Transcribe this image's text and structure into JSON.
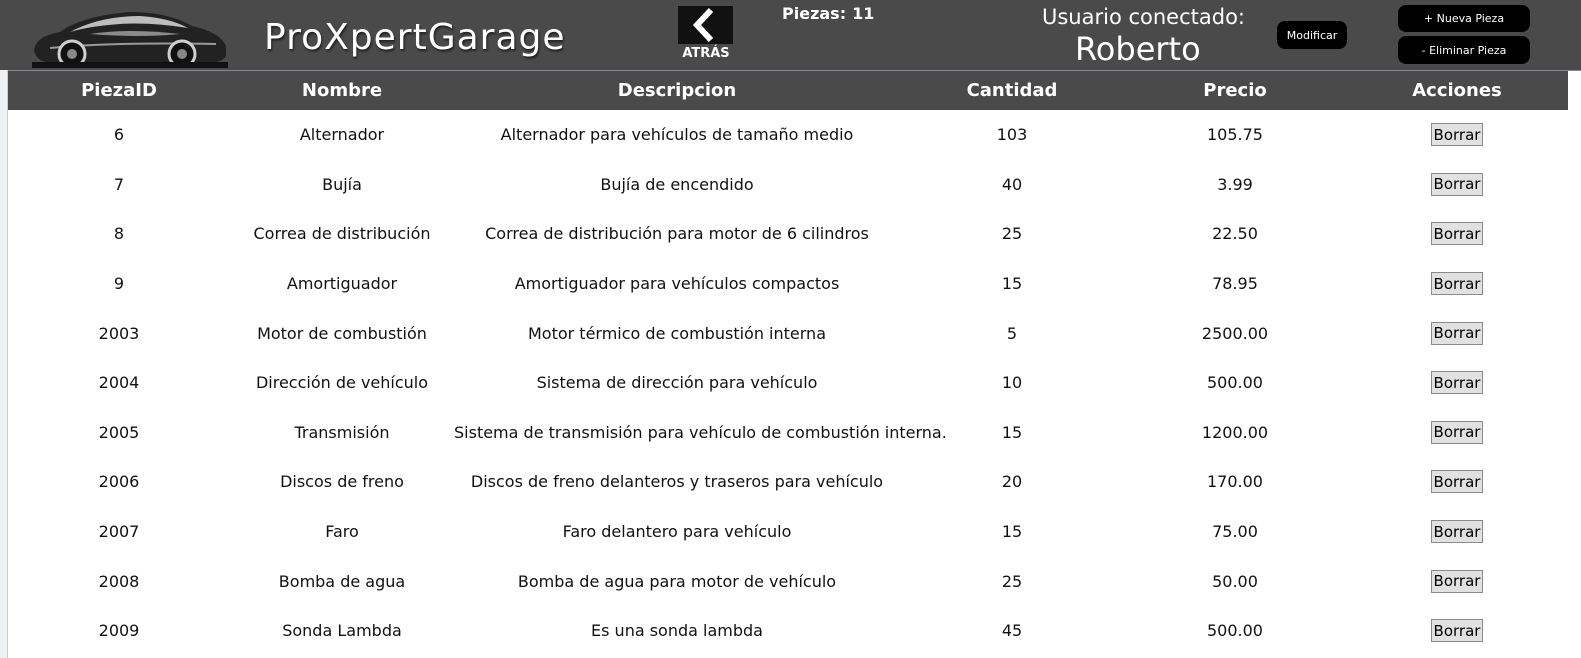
{
  "header": {
    "app_title": "ProXpertGarage",
    "back_label": "ATRÁS",
    "pieces_label": "Piezas:",
    "pieces_count": "11",
    "user_label": "Usuario conectado:",
    "user_name": "Roberto",
    "modify_label": "Modificar",
    "new_piece_label": "+ Nueva Pieza",
    "delete_piece_label": "- Eliminar Pieza",
    "logo_icon": "car-logo-icon",
    "back_icon": "chevron-left-icon"
  },
  "colors": {
    "header_bg": "#4a4a4a",
    "button_bg": "#000000",
    "row_button_bg": "#e1e1e1"
  },
  "table": {
    "columns": [
      "PiezaID",
      "Nombre",
      "Descripcion",
      "Cantidad",
      "Precio",
      "Acciones"
    ],
    "action_label": "Borrar",
    "rows": [
      {
        "id": "6",
        "nombre": "Alternador",
        "descripcion": "Alternador para vehículos de tamaño medio",
        "cantidad": "103",
        "precio": "105.75"
      },
      {
        "id": "7",
        "nombre": "Bujía",
        "descripcion": "Bujía de encendido",
        "cantidad": "40",
        "precio": "3.99"
      },
      {
        "id": "8",
        "nombre": "Correa de distribución",
        "descripcion": "Correa de distribución para motor de 6 cilindros",
        "cantidad": "25",
        "precio": "22.50"
      },
      {
        "id": "9",
        "nombre": "Amortiguador",
        "descripcion": "Amortiguador para vehículos compactos",
        "cantidad": "15",
        "precio": "78.95"
      },
      {
        "id": "2003",
        "nombre": "Motor de combustión",
        "descripcion": "Motor térmico de combustión interna",
        "cantidad": "5",
        "precio": "2500.00"
      },
      {
        "id": "2004",
        "nombre": "Dirección de vehículo",
        "descripcion": "Sistema de dirección para vehículo",
        "cantidad": "10",
        "precio": "500.00"
      },
      {
        "id": "2005",
        "nombre": "Transmisión",
        "descripcion": "Sistema de transmisión para vehículo de combustión interna.",
        "cantidad": "15",
        "precio": "1200.00"
      },
      {
        "id": "2006",
        "nombre": "Discos de freno",
        "descripcion": "Discos de freno delanteros y traseros para vehículo",
        "cantidad": "20",
        "precio": "170.00"
      },
      {
        "id": "2007",
        "nombre": "Faro",
        "descripcion": "Faro delantero para vehículo",
        "cantidad": "15",
        "precio": "75.00"
      },
      {
        "id": "2008",
        "nombre": "Bomba de agua",
        "descripcion": "Bomba de agua para motor de vehículo",
        "cantidad": "25",
        "precio": "50.00"
      },
      {
        "id": "2009",
        "nombre": "Sonda Lambda",
        "descripcion": "Es una sonda lambda",
        "cantidad": "45",
        "precio": "500.00"
      }
    ]
  }
}
